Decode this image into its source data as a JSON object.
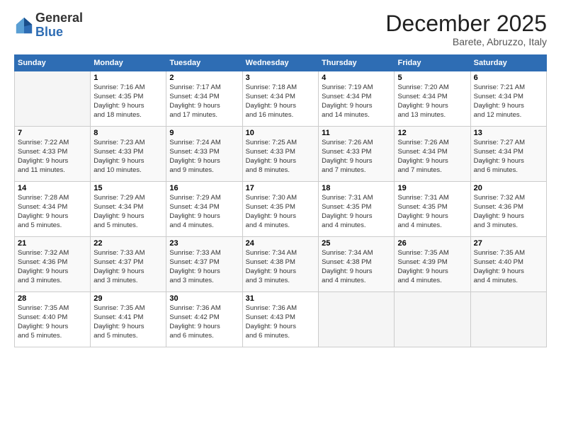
{
  "header": {
    "logo_line1": "General",
    "logo_line2": "Blue",
    "month": "December 2025",
    "location": "Barete, Abruzzo, Italy"
  },
  "weekdays": [
    "Sunday",
    "Monday",
    "Tuesday",
    "Wednesday",
    "Thursday",
    "Friday",
    "Saturday"
  ],
  "weeks": [
    [
      {
        "day": "",
        "info": ""
      },
      {
        "day": "1",
        "info": "Sunrise: 7:16 AM\nSunset: 4:35 PM\nDaylight: 9 hours\nand 18 minutes."
      },
      {
        "day": "2",
        "info": "Sunrise: 7:17 AM\nSunset: 4:34 PM\nDaylight: 9 hours\nand 17 minutes."
      },
      {
        "day": "3",
        "info": "Sunrise: 7:18 AM\nSunset: 4:34 PM\nDaylight: 9 hours\nand 16 minutes."
      },
      {
        "day": "4",
        "info": "Sunrise: 7:19 AM\nSunset: 4:34 PM\nDaylight: 9 hours\nand 14 minutes."
      },
      {
        "day": "5",
        "info": "Sunrise: 7:20 AM\nSunset: 4:34 PM\nDaylight: 9 hours\nand 13 minutes."
      },
      {
        "day": "6",
        "info": "Sunrise: 7:21 AM\nSunset: 4:34 PM\nDaylight: 9 hours\nand 12 minutes."
      }
    ],
    [
      {
        "day": "7",
        "info": "Sunrise: 7:22 AM\nSunset: 4:33 PM\nDaylight: 9 hours\nand 11 minutes."
      },
      {
        "day": "8",
        "info": "Sunrise: 7:23 AM\nSunset: 4:33 PM\nDaylight: 9 hours\nand 10 minutes."
      },
      {
        "day": "9",
        "info": "Sunrise: 7:24 AM\nSunset: 4:33 PM\nDaylight: 9 hours\nand 9 minutes."
      },
      {
        "day": "10",
        "info": "Sunrise: 7:25 AM\nSunset: 4:33 PM\nDaylight: 9 hours\nand 8 minutes."
      },
      {
        "day": "11",
        "info": "Sunrise: 7:26 AM\nSunset: 4:33 PM\nDaylight: 9 hours\nand 7 minutes."
      },
      {
        "day": "12",
        "info": "Sunrise: 7:26 AM\nSunset: 4:34 PM\nDaylight: 9 hours\nand 7 minutes."
      },
      {
        "day": "13",
        "info": "Sunrise: 7:27 AM\nSunset: 4:34 PM\nDaylight: 9 hours\nand 6 minutes."
      }
    ],
    [
      {
        "day": "14",
        "info": "Sunrise: 7:28 AM\nSunset: 4:34 PM\nDaylight: 9 hours\nand 5 minutes."
      },
      {
        "day": "15",
        "info": "Sunrise: 7:29 AM\nSunset: 4:34 PM\nDaylight: 9 hours\nand 5 minutes."
      },
      {
        "day": "16",
        "info": "Sunrise: 7:29 AM\nSunset: 4:34 PM\nDaylight: 9 hours\nand 4 minutes."
      },
      {
        "day": "17",
        "info": "Sunrise: 7:30 AM\nSunset: 4:35 PM\nDaylight: 9 hours\nand 4 minutes."
      },
      {
        "day": "18",
        "info": "Sunrise: 7:31 AM\nSunset: 4:35 PM\nDaylight: 9 hours\nand 4 minutes."
      },
      {
        "day": "19",
        "info": "Sunrise: 7:31 AM\nSunset: 4:35 PM\nDaylight: 9 hours\nand 4 minutes."
      },
      {
        "day": "20",
        "info": "Sunrise: 7:32 AM\nSunset: 4:36 PM\nDaylight: 9 hours\nand 3 minutes."
      }
    ],
    [
      {
        "day": "21",
        "info": "Sunrise: 7:32 AM\nSunset: 4:36 PM\nDaylight: 9 hours\nand 3 minutes."
      },
      {
        "day": "22",
        "info": "Sunrise: 7:33 AM\nSunset: 4:37 PM\nDaylight: 9 hours\nand 3 minutes."
      },
      {
        "day": "23",
        "info": "Sunrise: 7:33 AM\nSunset: 4:37 PM\nDaylight: 9 hours\nand 3 minutes."
      },
      {
        "day": "24",
        "info": "Sunrise: 7:34 AM\nSunset: 4:38 PM\nDaylight: 9 hours\nand 3 minutes."
      },
      {
        "day": "25",
        "info": "Sunrise: 7:34 AM\nSunset: 4:38 PM\nDaylight: 9 hours\nand 4 minutes."
      },
      {
        "day": "26",
        "info": "Sunrise: 7:35 AM\nSunset: 4:39 PM\nDaylight: 9 hours\nand 4 minutes."
      },
      {
        "day": "27",
        "info": "Sunrise: 7:35 AM\nSunset: 4:40 PM\nDaylight: 9 hours\nand 4 minutes."
      }
    ],
    [
      {
        "day": "28",
        "info": "Sunrise: 7:35 AM\nSunset: 4:40 PM\nDaylight: 9 hours\nand 5 minutes."
      },
      {
        "day": "29",
        "info": "Sunrise: 7:35 AM\nSunset: 4:41 PM\nDaylight: 9 hours\nand 5 minutes."
      },
      {
        "day": "30",
        "info": "Sunrise: 7:36 AM\nSunset: 4:42 PM\nDaylight: 9 hours\nand 6 minutes."
      },
      {
        "day": "31",
        "info": "Sunrise: 7:36 AM\nSunset: 4:43 PM\nDaylight: 9 hours\nand 6 minutes."
      },
      {
        "day": "",
        "info": ""
      },
      {
        "day": "",
        "info": ""
      },
      {
        "day": "",
        "info": ""
      }
    ]
  ]
}
